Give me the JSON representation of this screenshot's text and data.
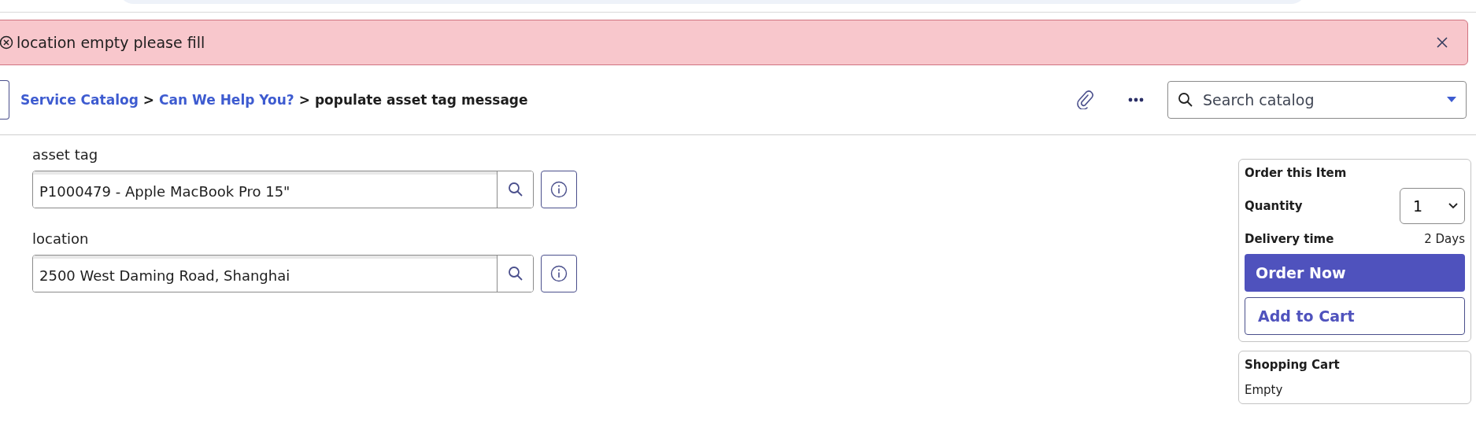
{
  "alert": {
    "message": "location empty please fill"
  },
  "breadcrumb": [
    {
      "label": "Service Catalog",
      "kind": "link"
    },
    {
      "separator": ">",
      "label": "Can We Help You?",
      "kind": "link"
    },
    {
      "separator": ">",
      "label": "populate asset tag message",
      "kind": "current"
    }
  ],
  "search": {
    "placeholder": "Search catalog"
  },
  "fields": [
    {
      "label": "asset tag",
      "value": "P1000479 - Apple MacBook Pro 15\""
    },
    {
      "label": "location",
      "value": "2500 West Daming Road, Shanghai"
    }
  ],
  "order": {
    "title": "Order this Item",
    "quantity_label": "Quantity",
    "quantity": "1",
    "delivery_label": "Delivery time",
    "delivery": "2 Days",
    "order_button": "Order Now",
    "cart_button": "Add to Cart"
  },
  "cart": {
    "title": "Shopping Cart",
    "status": "Empty"
  }
}
